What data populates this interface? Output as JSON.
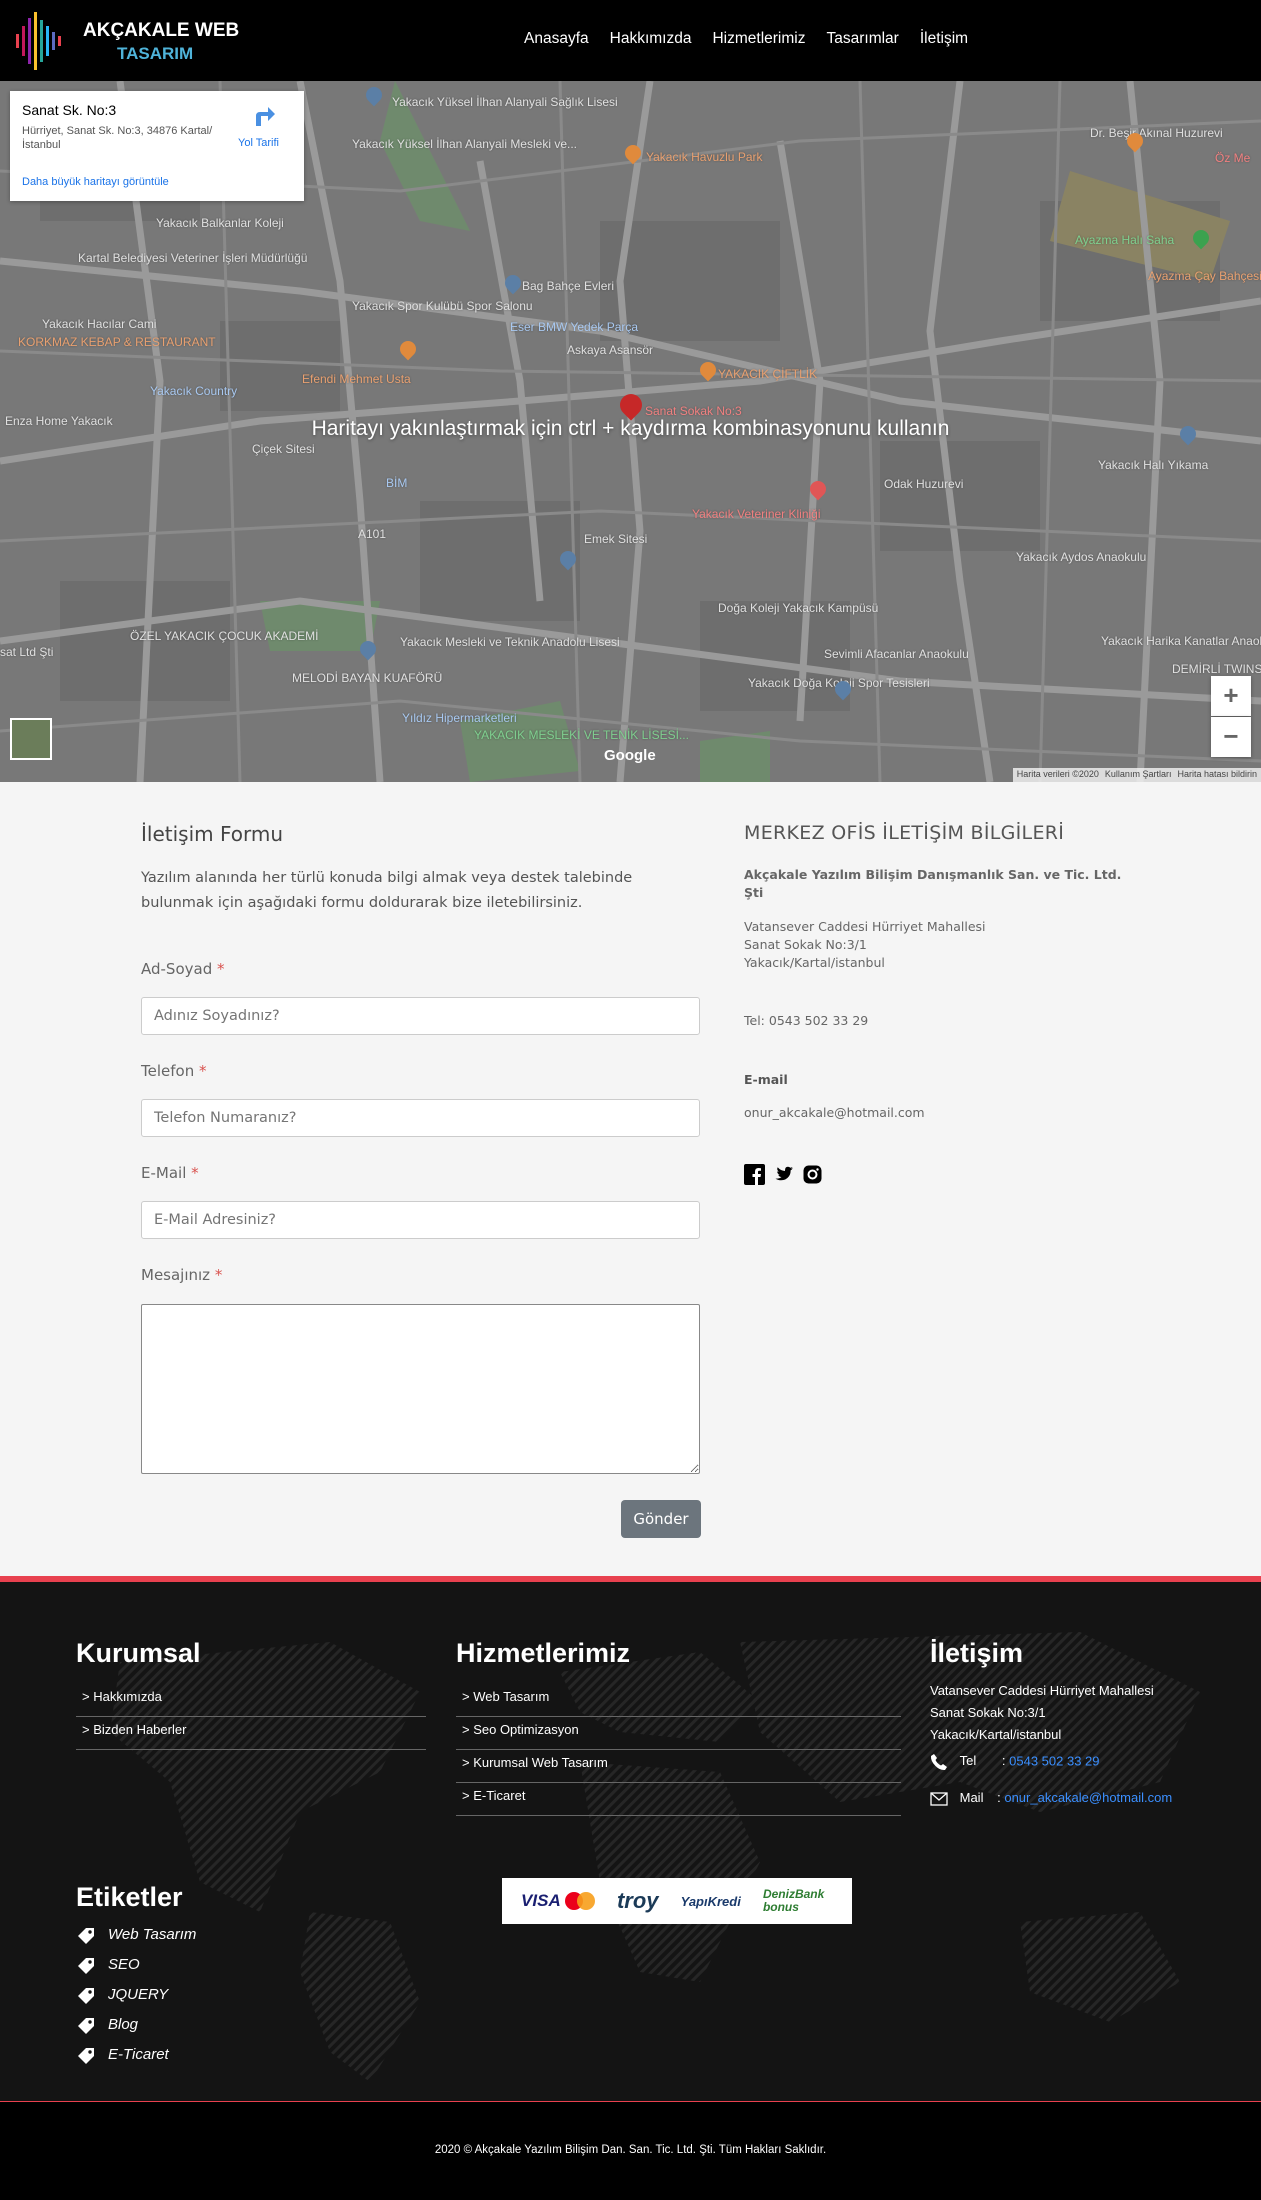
{
  "header": {
    "logo_line1": "AKÇAKALE WEB",
    "logo_line2": "TASARIM",
    "nav": [
      "Anasayfa",
      "Hakkımızda",
      "Hizmetlerimiz",
      "Tasarımlar",
      "İletişim"
    ]
  },
  "map": {
    "overlay_text": "Haritayı yakınlaştırmak için ctrl + kaydırma kombinasyonunu kullanın",
    "info_place": "Sanat Sk. No:3",
    "info_address": "Hürriyet, Sanat Sk. No:3, 34876 Kartal/İstanbul",
    "info_bigger_map": "Daha büyük haritayı görüntüle",
    "info_directions": "Yol Tarifi",
    "zoom_in": "+",
    "zoom_out": "−",
    "google": "Google",
    "footer_links": [
      "Harita verileri ©2020",
      "Kullanım Şartları",
      "Harita hatası bildirin"
    ],
    "labels": [
      "Yakacık Yüksel İlhan Alanyali Sağlık Lisesi",
      "Yakacık Yüksel İlhan Alanyali Mesleki ve...",
      "Yakacık Havuzlu Park",
      "Dr. Beşir Akınal Huzurevi",
      "Yakacık Balkanlar Koleji",
      "Kartal Belediyesi Veteriner İşleri Müdürlüğü",
      "Ayazma Halı Saha",
      "Ayazma Çay Bahçesi",
      "Bag Bahçe Evleri",
      "Yakacık Spor Kulübü Spor Salonu",
      "Eser BMW Yedek Parça",
      "Askaya Asansör",
      "Yakacık Hacılar Cami",
      "KORKMAZ KEBAP & RESTAURANT",
      "Efendi Mehmet Usta",
      "YAKACIK ÇİFTLİK",
      "Sanat Sokak No:3",
      "Yakacık Country",
      "Enza Home Yakacık",
      "Çiçek Sitesi",
      "Yakacık Halı Yıkama",
      "BİM",
      "Odak Huzurevi",
      "Yakacık Veteriner Kliniği",
      "A101",
      "Emek Sitesi",
      "Yakacık Aydos Anaokulu",
      "ÖZEL YAKACIK ÇOCUK AKADEMİ",
      "Doğa Koleji Yakacık Kampüsü",
      "Yakacık Harika Kanatlar Anaokulu",
      "Yakacık Mesleki ve Teknik Anadolu Lisesi",
      "Sevimli Afacanlar Anaokulu",
      "MELODİ BAYAN KUAFÖRÜ",
      "Yakacık Doğa Koleji Spor Tesisleri",
      "Yıldız Hipermarketleri",
      "YAKACIK MESLEKİ VE TENİK LİSESİ...",
      "DEMİRLİ TWINSTA",
      "sat Ltd Şti",
      "Öz Me"
    ]
  },
  "contact_form": {
    "title": "İletişim Formu",
    "description": "Yazılım alanında her türlü konuda bilgi almak veya destek talebinde bulunmak için aşağıdaki formu doldurarak bize iletebilirsiniz.",
    "name_label": "Ad-Soyad",
    "name_placeholder": "Adınız Soyadınız?",
    "phone_label": "Telefon",
    "phone_placeholder": "Telefon Numaranız?",
    "email_label": "E-Mail",
    "email_placeholder": "E-Mail Adresiniz?",
    "message_label": "Mesajınız",
    "required_mark": "*",
    "submit": "Gönder"
  },
  "office": {
    "title": "MERKEZ OFİS İLETİŞİM BİLGİLERİ",
    "company": "Akçakale Yazılım Bilişim Danışmanlık San. ve Tic. Ltd. Şti",
    "address_lines": [
      "Vatansever Caddesi Hürriyet Mahallesi",
      "Sanat Sokak No:3/1",
      "Yakacık/Kartal/istanbul"
    ],
    "phone": "Tel: 0543 502 33 29",
    "email_title": "E-mail",
    "email": "onur_akcakale@hotmail.com",
    "social": [
      "facebook-icon",
      "twitter-icon",
      "instagram-icon"
    ]
  },
  "footer": {
    "corporate_title": "Kurumsal",
    "corporate_links": [
      "> Hakkımızda",
      "> Bizden Haberler"
    ],
    "services_title": "Hizmetlerimiz",
    "services_links": [
      "> Web Tasarım",
      "> Seo Optimizasyon",
      "> Kurumsal Web Tasarım",
      "> E-Ticaret"
    ],
    "contact_title": "İletişim",
    "contact_address": [
      "Vatansever Caddesi Hürriyet Mahallesi",
      "Sanat Sokak No:3/1",
      "Yakacık/Kartal/istanbul"
    ],
    "tel_label": "Tel",
    "tel_value": "0543 502 33 29",
    "mail_label": "Mail",
    "mail_value": "onur_akcakale@hotmail.com",
    "separator": ":",
    "tags_title": "Etiketler",
    "tags": [
      "Web Tasarım",
      "SEO",
      "JQUERY",
      "Blog",
      "E-Ticaret"
    ],
    "payment_logos": [
      "VISA",
      "troy",
      "YapıKredi",
      "DenizBank bonus"
    ],
    "accent_color": "#e8414f",
    "link_color": "#3b8fff"
  },
  "copyright": "2020 © Akçakale Yazılım Bilişim Dan. San. Tic. Ltd. Şti. Tüm Hakları Saklıdır."
}
